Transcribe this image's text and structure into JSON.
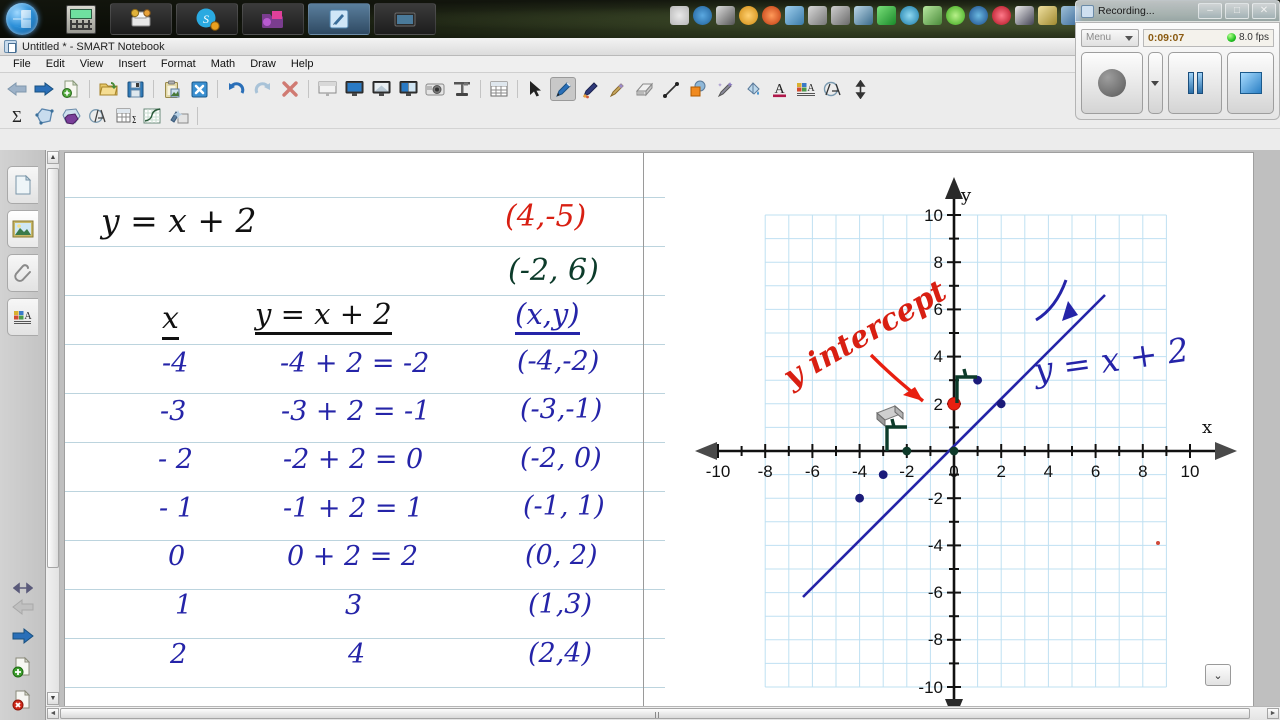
{
  "taskbar": {
    "start_label": "start-orb",
    "apps": [
      "calculator",
      "printer-sharing",
      "skype",
      "folder-pink",
      "smart-notebook",
      "media"
    ],
    "tray_count": 16
  },
  "window": {
    "title": "Untitled * - SMART Notebook",
    "menus": [
      "File",
      "Edit",
      "View",
      "Insert",
      "Format",
      "Math",
      "Draw",
      "Help"
    ]
  },
  "toolbar": {
    "row1": [
      {
        "name": "back-arrow-icon",
        "glyph": "←",
        "color": "#8fa6c4"
      },
      {
        "name": "forward-arrow-icon",
        "glyph": "→",
        "color": "#1f5fa8"
      },
      {
        "name": "new-page-icon",
        "glyph": "🗎",
        "color": "#4a8a3a"
      },
      {
        "name": "open-file-icon",
        "glyph": "📂",
        "color": "#c9a23a"
      },
      {
        "name": "save-icon",
        "glyph": "💾",
        "color": "#2a6ca8"
      },
      {
        "name": "paste-icon",
        "glyph": "📋",
        "color": "#b79b4a"
      },
      {
        "name": "screen-shade-icon",
        "glyph": "✖",
        "color": "#2a7fc4"
      },
      {
        "name": "undo-icon",
        "glyph": "↺",
        "color": "#2a6ca8"
      },
      {
        "name": "redo-icon",
        "glyph": "↻",
        "color": "#a8bdd0"
      },
      {
        "name": "delete-icon",
        "glyph": "✕",
        "color": "#cf5a52"
      },
      {
        "name": "screen-shade-panel-icon",
        "glyph": "▭",
        "color": "#8a8a8a"
      },
      {
        "name": "full-screen-icon",
        "glyph": "🖵",
        "color": "#2a6ca8"
      },
      {
        "name": "dual-page-icon",
        "glyph": "🖵",
        "color": "#6b8ba8"
      },
      {
        "name": "transparent-bg-icon",
        "glyph": "🖵",
        "color": "#2a6ca8"
      },
      {
        "name": "camera-capture-icon",
        "glyph": "📷",
        "color": "#777"
      },
      {
        "name": "document-camera-icon",
        "glyph": "⌷",
        "color": "#555"
      },
      {
        "name": "insert-table-icon",
        "glyph": "▦",
        "color": "#6a6a6a"
      },
      {
        "name": "select-pointer-icon",
        "glyph": "➤",
        "color": "#333"
      },
      {
        "name": "pen-icon",
        "glyph": "✎",
        "color": "#2a6ca8"
      },
      {
        "name": "creative-pen-icon",
        "glyph": "✏",
        "color": "#3a3a7a"
      },
      {
        "name": "magic-pen-icon",
        "glyph": "✒",
        "color": "#b08a4a"
      },
      {
        "name": "eraser-icon",
        "glyph": "◧",
        "color": "#8a8a8a"
      },
      {
        "name": "line-tool-icon",
        "glyph": "╱",
        "color": "#333"
      },
      {
        "name": "shapes-icon",
        "glyph": "◼",
        "color": "#e08a2a"
      },
      {
        "name": "shape-pen-icon",
        "glyph": "✦",
        "color": "#6a5a9a"
      },
      {
        "name": "fill-icon",
        "glyph": "🪣",
        "color": "#5a8ac4"
      },
      {
        "name": "text-color-icon",
        "glyph": "A",
        "color": "#222"
      },
      {
        "name": "properties-icon",
        "glyph": "A",
        "color": "#222"
      },
      {
        "name": "measurement-tools-icon",
        "glyph": "Ⓐ",
        "color": "#555"
      },
      {
        "name": "move-toolbar-icon",
        "glyph": "↕",
        "color": "#333"
      }
    ],
    "row2": [
      {
        "name": "sum-equation-icon",
        "glyph": "Σ",
        "color": "#222"
      },
      {
        "name": "irregular-polygon-icon",
        "glyph": "⬠",
        "color": "#5a8ac4"
      },
      {
        "name": "regular-polygon-icon",
        "glyph": "⬢",
        "color": "#7a4a9a"
      },
      {
        "name": "compass-icon",
        "glyph": "⊿",
        "color": "#6a8aa8"
      },
      {
        "name": "table-sum-icon",
        "glyph": "▦",
        "color": "#6a6a6a"
      },
      {
        "name": "graph-plot-icon",
        "glyph": "📈",
        "color": "#4a7a5a"
      },
      {
        "name": "smart-blocks-icon",
        "glyph": "❖",
        "color": "#6a8aa8"
      }
    ]
  },
  "sidebar": {
    "tabs": [
      {
        "name": "page-sorter",
        "glyph": "🗎"
      },
      {
        "name": "gallery",
        "glyph": "🖼"
      },
      {
        "name": "attachments",
        "glyph": "📎"
      },
      {
        "name": "properties",
        "glyph": "A"
      }
    ],
    "selected_index": 1,
    "bottom": [
      {
        "name": "prev-page",
        "glyph": "←"
      },
      {
        "name": "next-page",
        "glyph": "→"
      },
      {
        "name": "add-page",
        "glyph": "＋"
      },
      {
        "name": "delete-page",
        "glyph": "✕"
      }
    ],
    "resize_handle": "↔"
  },
  "notes": {
    "equation_title": "y = x + 2",
    "red_pair": "(4,-5)",
    "green_pair": "(-2, 6)",
    "headers": {
      "col1": "x",
      "col2": "y = x + 2",
      "col3": "(x,y)"
    },
    "rows": [
      {
        "x": "-4",
        "work": "-4 + 2 = -2",
        "pair": "(-4,-2)"
      },
      {
        "x": "-3",
        "work": "-3 + 2 = -1",
        "pair": "(-3,-1)"
      },
      {
        "x": "- 2",
        "work": "-2 + 2 = 0",
        "pair": "(-2, 0)"
      },
      {
        "x": "- 1",
        "work": "-1 + 2 = 1",
        "pair": "(-1, 1)"
      },
      {
        "x": "0",
        "work": "0 + 2 = 2",
        "pair": "(0, 2)"
      },
      {
        "x": "1",
        "work": "3",
        "pair": "(1,3)"
      },
      {
        "x": "2",
        "work": "4",
        "pair": "(2,4)"
      }
    ]
  },
  "graph_annotations": {
    "y_intercept_label": "y intercept",
    "line_equation_label": "y = x + 2",
    "axis_x_label": "x",
    "axis_y_label": "y"
  },
  "recorder": {
    "title": "Recording...",
    "minimize": "–",
    "maximize": "□",
    "close": "✕",
    "menu_label": "Menu",
    "timer": "0:09:07",
    "fps": "8.0 fps",
    "record_button": "record",
    "pause_button": "pause",
    "stop_button": "stop"
  },
  "page_nav": {
    "next_glyph": "⌄",
    "hscroll_left": "◄",
    "hscroll_right": "►",
    "vscroll_up": "▲",
    "vscroll_down": "▼"
  },
  "chart_data": {
    "type": "line",
    "title": "y = x + 2",
    "xlabel": "x",
    "ylabel": "y",
    "xlim": [
      -10,
      10
    ],
    "ylim": [
      -10,
      10
    ],
    "x_ticks": [
      -10,
      -8,
      -6,
      -4,
      -2,
      0,
      2,
      4,
      6,
      8,
      10
    ],
    "y_ticks": [
      10,
      8,
      6,
      4,
      2,
      -2,
      -4,
      -6,
      -8,
      -10
    ],
    "grid": true,
    "legend": "none",
    "series": [
      {
        "name": "y = x + 2",
        "color": "#2524a8",
        "x": [
          -8.2,
          6.4
        ],
        "y": [
          -6.2,
          8.4
        ],
        "points": [
          {
            "x": -4,
            "y": -2
          },
          {
            "x": -3,
            "y": -1
          },
          {
            "x": -2,
            "y": 0
          },
          {
            "x": 0,
            "y": 2
          },
          {
            "x": 1,
            "y": 3
          },
          {
            "x": 2,
            "y": 4
          }
        ]
      }
    ],
    "highlight_point": {
      "x": 0,
      "y": 2,
      "color": "#e81f10",
      "label": "y intercept"
    },
    "annotations": [
      {
        "text": "y intercept",
        "color": "#e81f10",
        "x": -5.0,
        "y": 4.5
      },
      {
        "text": "y = x + 2",
        "color": "#2524a8",
        "x": 3.2,
        "y": 2.2
      }
    ]
  }
}
